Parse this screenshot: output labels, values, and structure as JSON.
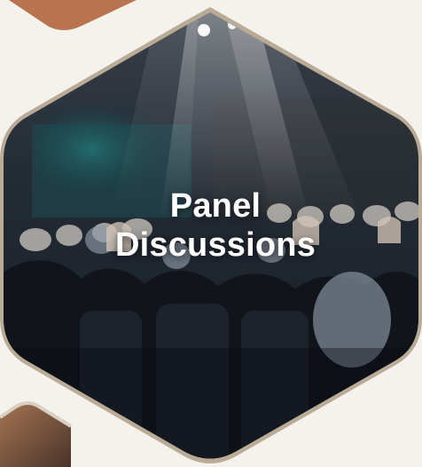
{
  "tile": {
    "title_line1": "Panel",
    "title_line2": "Discussions"
  },
  "colors": {
    "page_background": "#f5f2ee",
    "hexagon_border": "#b9ab95",
    "accent_shape": "#b8744e",
    "title_text": "#ffffff"
  },
  "icons": {
    "top_shape": "hexagon-fragment",
    "bottom_left_shape": "hexagon-fragment"
  }
}
